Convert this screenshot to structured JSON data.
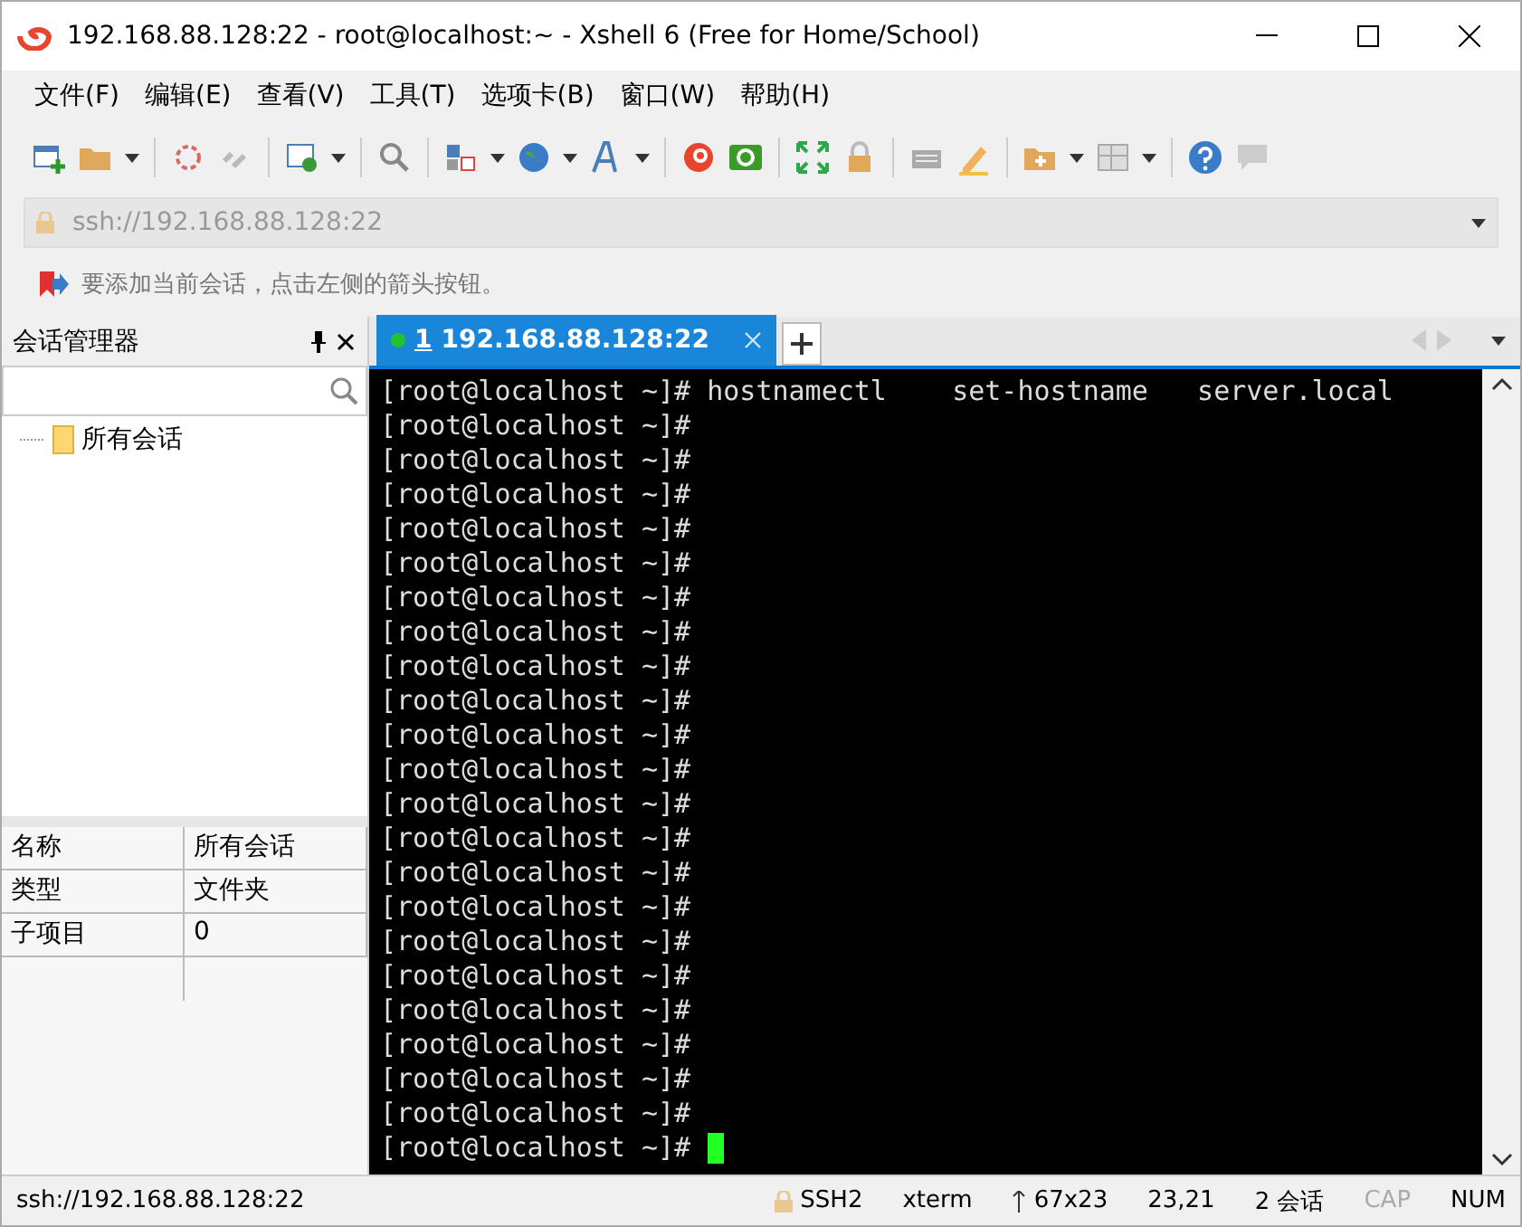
{
  "window": {
    "title": "192.168.88.128:22 - root@localhost:~ - Xshell 6 (Free for Home/School)"
  },
  "menu": [
    "文件(F)",
    "编辑(E)",
    "查看(V)",
    "工具(T)",
    "选项卡(B)",
    "窗口(W)",
    "帮助(H)"
  ],
  "address": {
    "placeholder": "ssh://192.168.88.128:22"
  },
  "hint": "要添加当前会话，点击左侧的箭头按钮。",
  "session_manager": {
    "title": "会话管理器",
    "tree": [
      {
        "label": "所有会话"
      }
    ],
    "properties": [
      {
        "name": "名称",
        "value": "所有会话"
      },
      {
        "name": "类型",
        "value": "文件夹"
      },
      {
        "name": "子项目",
        "value": "0"
      }
    ]
  },
  "tabs": [
    {
      "number": "1",
      "label": "192.168.88.128:22",
      "selected": true,
      "connected": true
    }
  ],
  "terminal": {
    "lines": [
      "[root@localhost ~]# hostnamectl    set-hostname   server.local",
      "[root@localhost ~]#",
      "[root@localhost ~]#",
      "[root@localhost ~]#",
      "[root@localhost ~]#",
      "[root@localhost ~]#",
      "[root@localhost ~]#",
      "[root@localhost ~]#",
      "[root@localhost ~]#",
      "[root@localhost ~]#",
      "[root@localhost ~]#",
      "[root@localhost ~]#",
      "[root@localhost ~]#",
      "[root@localhost ~]#",
      "[root@localhost ~]#",
      "[root@localhost ~]#",
      "[root@localhost ~]#",
      "[root@localhost ~]#",
      "[root@localhost ~]#",
      "[root@localhost ~]#",
      "[root@localhost ~]#",
      "[root@localhost ~]#",
      "[root@localhost ~]# "
    ]
  },
  "status_bar": {
    "address": "ssh://192.168.88.128:22",
    "protocol": "SSH2",
    "terminal_type": "xterm",
    "size": "67x23",
    "cursor": "23,21",
    "sessions": "2 会话",
    "locks": [
      {
        "label": "CAP",
        "on": false
      },
      {
        "label": "NUM",
        "on": true
      }
    ]
  }
}
